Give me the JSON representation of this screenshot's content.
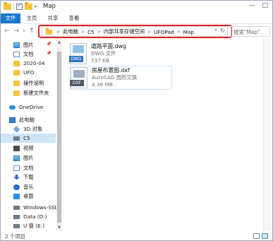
{
  "window": {
    "title": "Map"
  },
  "titlebar": {
    "controls": [
      "—",
      "□"
    ]
  },
  "ribbon": {
    "tabs": [
      "文件",
      "主页",
      "共享",
      "查看"
    ],
    "active_tab": "文件"
  },
  "nav": {
    "back_icon": "←",
    "forward_icon": "→",
    "recent_icon": "∨",
    "up_icon": "↑",
    "breadcrumb": [
      "此电脑",
      "C5",
      "内部共享存储空间",
      "UFOPad",
      "Map"
    ],
    "dropdown_icon": "∨",
    "refresh_icon": "↻",
    "search_placeholder": "搜索\"Map\""
  },
  "sidebar": {
    "items": [
      {
        "label": "图片",
        "icon": "image-icon",
        "pinned": true
      },
      {
        "label": "文档",
        "icon": "document-icon",
        "pinned": true
      },
      {
        "label": "2020-04",
        "icon": "folder-icon",
        "pinned": false
      },
      {
        "label": "UFO",
        "icon": "folder-icon",
        "pinned": false
      },
      {
        "label": "操作说明",
        "icon": "folder-icon",
        "pinned": false
      },
      {
        "label": "新建文件夹",
        "icon": "folder-icon",
        "pinned": false
      },
      {
        "label": "OneDrive",
        "icon": "cloud-icon",
        "pinned": false
      },
      {
        "label": "此电脑",
        "icon": "computer-icon",
        "pinned": false
      },
      {
        "label": "3D 对象",
        "icon": "3d-objects-icon",
        "pinned": false
      },
      {
        "label": "C5",
        "icon": "device-icon",
        "pinned": false,
        "selected": true
      },
      {
        "label": "视频",
        "icon": "video-icon",
        "pinned": false
      },
      {
        "label": "图片",
        "icon": "image-icon",
        "pinned": false
      },
      {
        "label": "文档",
        "icon": "document-icon",
        "pinned": false
      },
      {
        "label": "下载",
        "icon": "download-icon",
        "pinned": false
      },
      {
        "label": "音乐",
        "icon": "music-icon",
        "pinned": false
      },
      {
        "label": "桌面",
        "icon": "desktop-icon",
        "pinned": false
      },
      {
        "label": "Windows-SSD (",
        "icon": "drive-icon",
        "pinned": false
      },
      {
        "label": "Data (D:)",
        "icon": "drive-icon",
        "pinned": false
      },
      {
        "label": "U 盘 (E:)",
        "icon": "drive-icon",
        "pinned": false
      }
    ],
    "pin_glyph": "📌"
  },
  "files": [
    {
      "name": "道路平面.dwg",
      "type": "DWG 文件",
      "size": "737 KB",
      "kind": "dwg"
    },
    {
      "name": "房屋布置图.dxf",
      "type": "AutoCAD 图形交换",
      "size": "4.36 MB",
      "kind": "dxf"
    }
  ],
  "status": {
    "item_count": "2 个项目"
  },
  "colors": {
    "accent": "#1979ca",
    "highlight_box": "#e22626",
    "selection": "#cce5f7"
  }
}
